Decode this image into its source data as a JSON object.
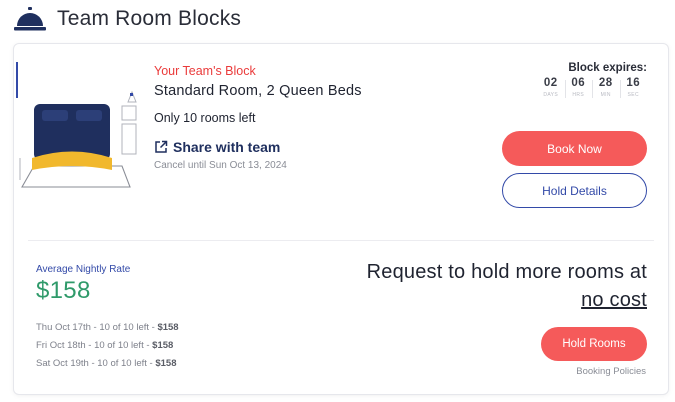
{
  "header": {
    "title": "Team Room Blocks",
    "icon": "service-bell-icon"
  },
  "block": {
    "label": "Your Team's Block",
    "room_type": "Standard Room, 2 Queen Beds",
    "rooms_left": "Only 10 rooms left",
    "share_label": "Share with team",
    "cancel_text": "Cancel until Sun Oct 13, 2024"
  },
  "expires": {
    "label": "Block expires:",
    "countdown": [
      {
        "value": "02",
        "unit": "DAYS"
      },
      {
        "value": "06",
        "unit": "HRS"
      },
      {
        "value": "28",
        "unit": "MIN"
      },
      {
        "value": "16",
        "unit": "SEC"
      }
    ]
  },
  "buttons": {
    "book_now": "Book Now",
    "hold_details": "Hold Details",
    "hold_rooms": "Hold Rooms"
  },
  "rates": {
    "label": "Average Nightly Rate",
    "price": "$158",
    "nights": [
      {
        "text": "Thu Oct 17th - 10 of 10 left - ",
        "price": "$158"
      },
      {
        "text": "Fri Oct 18th - 10 of 10 left - ",
        "price": "$158"
      },
      {
        "text": "Sat Oct 19th - 10 of 10 left - ",
        "price": "$158"
      }
    ]
  },
  "request": {
    "line1": "Request to hold more rooms at",
    "line2": "no cost"
  },
  "policies": "Booking Policies",
  "colors": {
    "accent_red": "#f55a5a",
    "brand_navy": "#1f2f5e",
    "link_blue": "#334aa8",
    "price_green": "#2f9a6a",
    "label_red": "#ea3b3b",
    "bed_yellow": "#f1b82d"
  }
}
